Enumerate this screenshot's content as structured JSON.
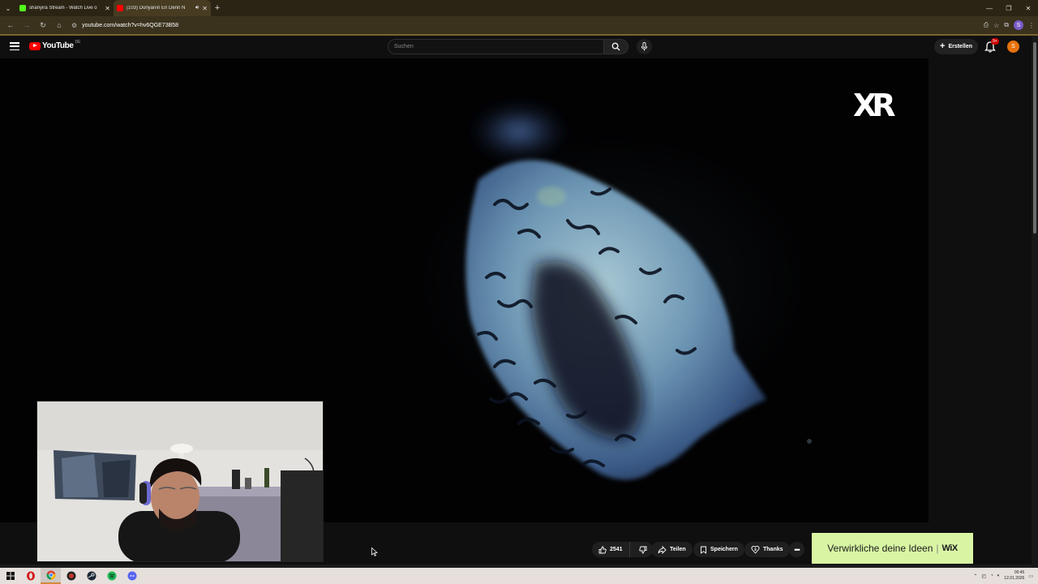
{
  "browser": {
    "tabs": [
      {
        "title": "shanyira Stream - Watch Live o",
        "favicon_color": "#53fc18",
        "active": false
      },
      {
        "title": "(103) Dünyanın En Derin N",
        "favicon_color": "#ff0000",
        "active": true
      }
    ],
    "url": "youtube.com/watch?v=hv6QGE73B58",
    "profile_initial": "S"
  },
  "youtube": {
    "logo_text": "YouTube",
    "country_code": "DE",
    "search_placeholder": "Suchen",
    "create_label": "Erstellen",
    "notification_badge": "9+",
    "avatar_initial": "S"
  },
  "video": {
    "watermark": "XR"
  },
  "actions": {
    "like_count": "2541",
    "share_label": "Teilen",
    "save_label": "Speichern",
    "thanks_label": "Thanks",
    "more_label": "•••"
  },
  "ad": {
    "text": "Verwirkliche deine Ideen",
    "brand": "WiX"
  },
  "taskbar": {
    "time": "00:45",
    "date": "12.01.2026"
  },
  "colors": {
    "accent_red": "#ff0000",
    "ad_bg": "#d9f5a4",
    "avatar": "#e8720c",
    "browser_frame": "#2b2414"
  }
}
